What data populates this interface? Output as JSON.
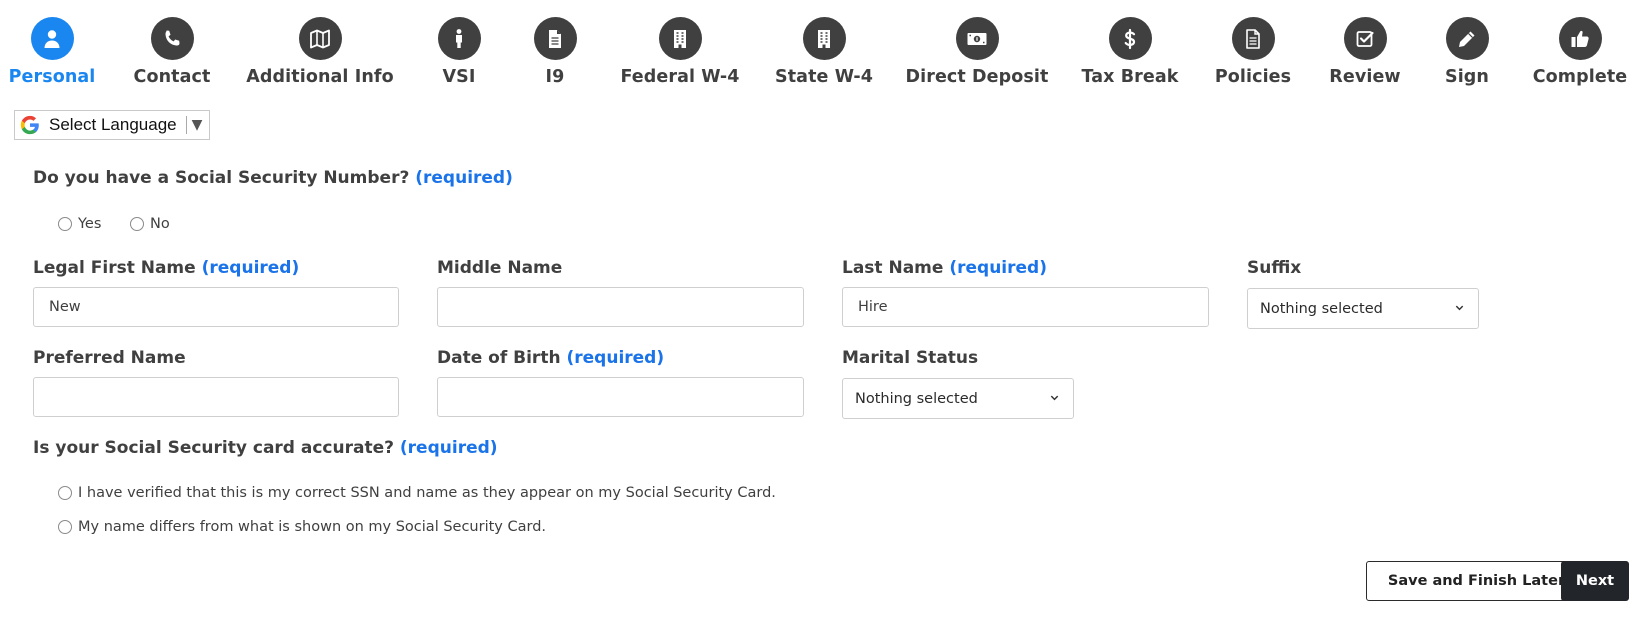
{
  "steps": [
    {
      "label": "Personal",
      "icon": "user-icon",
      "active": true
    },
    {
      "label": "Contact",
      "icon": "phone-icon"
    },
    {
      "label": "Additional Info",
      "icon": "map-icon"
    },
    {
      "label": "VSI",
      "icon": "person-icon"
    },
    {
      "label": "I9",
      "icon": "document-icon"
    },
    {
      "label": "Federal W-4",
      "icon": "building-icon"
    },
    {
      "label": "State W-4",
      "icon": "building-icon"
    },
    {
      "label": "Direct Deposit",
      "icon": "money-icon"
    },
    {
      "label": "Tax Break",
      "icon": "dollar-icon"
    },
    {
      "label": "Policies",
      "icon": "document-icon"
    },
    {
      "label": "Review",
      "icon": "checkbox-icon"
    },
    {
      "label": "Sign",
      "icon": "pencil-icon"
    },
    {
      "label": "Complete",
      "icon": "thumbs-up-icon"
    }
  ],
  "colors": {
    "accent": "#1a86f0",
    "required": "#1a73e8",
    "icon_bg": "#404040",
    "dark_button": "#222529"
  },
  "language": {
    "label": "Select Language"
  },
  "form": {
    "ssn_question": {
      "text": "Do you have a Social Security Number?",
      "req": "(required)",
      "options": [
        "Yes",
        "No"
      ]
    },
    "first_name": {
      "label": "Legal First Name",
      "req": "(required)",
      "value": "New"
    },
    "middle_name": {
      "label": "Middle Name",
      "value": ""
    },
    "last_name": {
      "label": "Last Name",
      "req": "(required)",
      "value": "Hire"
    },
    "suffix": {
      "label": "Suffix",
      "value": "Nothing selected"
    },
    "preferred_name": {
      "label": "Preferred Name",
      "value": ""
    },
    "dob": {
      "label": "Date of Birth",
      "req": "(required)",
      "value": ""
    },
    "marital_status": {
      "label": "Marital Status",
      "value": "Nothing selected"
    },
    "card_question": {
      "text": "Is your Social Security card accurate?",
      "req": "(required)",
      "options": [
        "I have verified that this is my correct SSN and name as they appear on my Social Security Card.",
        "My name differs from what is shown on my Social Security Card."
      ]
    }
  },
  "buttons": {
    "save_later": "Save and Finish Later",
    "next": "Next"
  }
}
